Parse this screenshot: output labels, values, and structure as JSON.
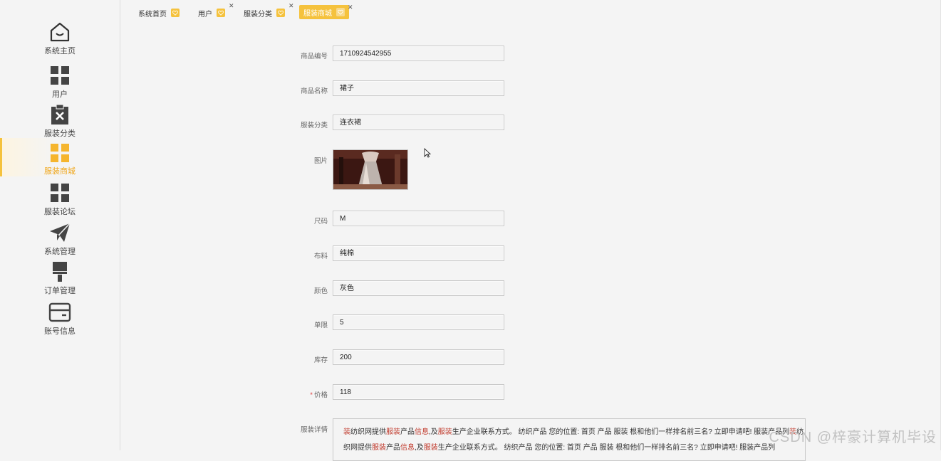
{
  "sidebar": {
    "items": [
      {
        "label": "系统主页",
        "icon": "home-icon"
      },
      {
        "label": "用户",
        "icon": "grid-icon"
      },
      {
        "label": "服装分类",
        "icon": "clipboard-x-icon"
      },
      {
        "label": "服装商城",
        "icon": "grid-icon",
        "active": true
      },
      {
        "label": "服装论坛",
        "icon": "grid-icon"
      },
      {
        "label": "系统管理",
        "icon": "paper-plane-icon"
      },
      {
        "label": "订单管理",
        "icon": "brush-icon"
      },
      {
        "label": "账号信息",
        "icon": "card-icon"
      }
    ]
  },
  "tabs": [
    {
      "label": "系统首页",
      "closable": false
    },
    {
      "label": "用户",
      "closable": true
    },
    {
      "label": "服装分类",
      "closable": true
    },
    {
      "label": "服装商城",
      "closable": true,
      "active": true
    }
  ],
  "form": {
    "code": {
      "label": "商品编号",
      "value": "1710924542955"
    },
    "name": {
      "label": "商品名称",
      "value": "裙子"
    },
    "category": {
      "label": "服装分类",
      "value": "连衣裙"
    },
    "image": {
      "label": "图片"
    },
    "size": {
      "label": "尺码",
      "value": "M"
    },
    "material": {
      "label": "布料",
      "value": "纯棉"
    },
    "color": {
      "label": "颜色",
      "value": "灰色"
    },
    "limit": {
      "label": "单限",
      "value": "5"
    },
    "stock": {
      "label": "库存",
      "value": "200"
    },
    "price": {
      "label": "价格",
      "required_mark": "*",
      "value": "118"
    },
    "detail": {
      "label": "服装详情",
      "line1_parts": [
        "装",
        "纺织网提供",
        "服装",
        "产品",
        "信息",
        ",及",
        "服装",
        "生产企业联系方式。 纺织产品 您的位置: 首页 产品 服装 根和他们一样排名前三名? 立即申请吧! 服装产品列",
        "装",
        "纺"
      ],
      "line2_parts": [
        "织网提供",
        "服装",
        "产品",
        "信息",
        ",及",
        "服装",
        "生产企业联系方式。 纺织产品 您的位置: 首页 产品 服装 根和他们一样排名前三名? 立即申请吧! 服装产品列"
      ]
    }
  },
  "watermark": "CSDN @梓豪计算机毕设",
  "colors": {
    "accent": "#f5c23d",
    "highlight": "#c0392b"
  }
}
